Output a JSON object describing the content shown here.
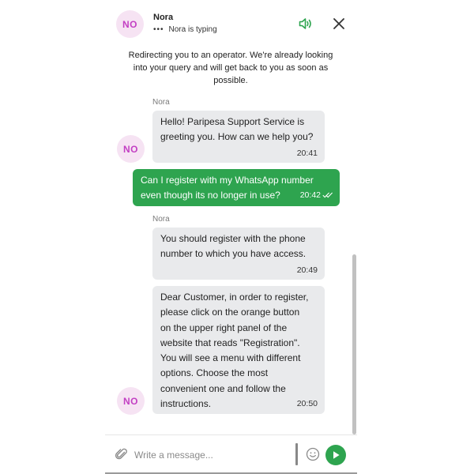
{
  "header": {
    "avatar_initials": "NO",
    "agent_name": "Nora",
    "typing_dots": "•••",
    "typing_status": "Nora is typing",
    "sound_icon": "speaker-icon",
    "close_icon": "close-icon"
  },
  "notice": "Redirecting you to an operator. We're already looking into your query and will get back to you as soon as possible.",
  "messages": [
    {
      "direction": "incoming",
      "sender": "Nora",
      "lines": [
        "Hello! Paripesa Support Service is",
        "greeting you. How can we help you?"
      ],
      "time": "20:41"
    },
    {
      "direction": "outgoing",
      "lines": [
        "Can I register with my WhatsApp number",
        "even though its no longer in use?"
      ],
      "time": "20:42",
      "status_icon": "double-check-icon"
    },
    {
      "direction": "incoming",
      "sender": "Nora",
      "lines": [
        "You should register with the phone",
        "number to which you have access."
      ],
      "time": "20:49"
    },
    {
      "direction": "incoming",
      "lines": [
        "Dear Customer, in order to register,",
        "please click on the orange button",
        "on the upper right panel of the",
        "website that reads \"Registration\".",
        "You will see a menu with different",
        "options. Choose the most",
        "convenient one and follow the",
        "instructions."
      ],
      "time": "20:50"
    }
  ],
  "message_avatar_initials": "NO",
  "composer": {
    "placeholder": "Write a message...",
    "attach_icon": "paperclip-icon",
    "emoji_icon": "smiley-icon",
    "send_icon": "send-icon"
  },
  "colors": {
    "accent_green": "#2ea44f",
    "avatar_bg": "#f6e3f3",
    "avatar_text": "#c33fc3",
    "incoming_bubble": "#e9eaec"
  }
}
